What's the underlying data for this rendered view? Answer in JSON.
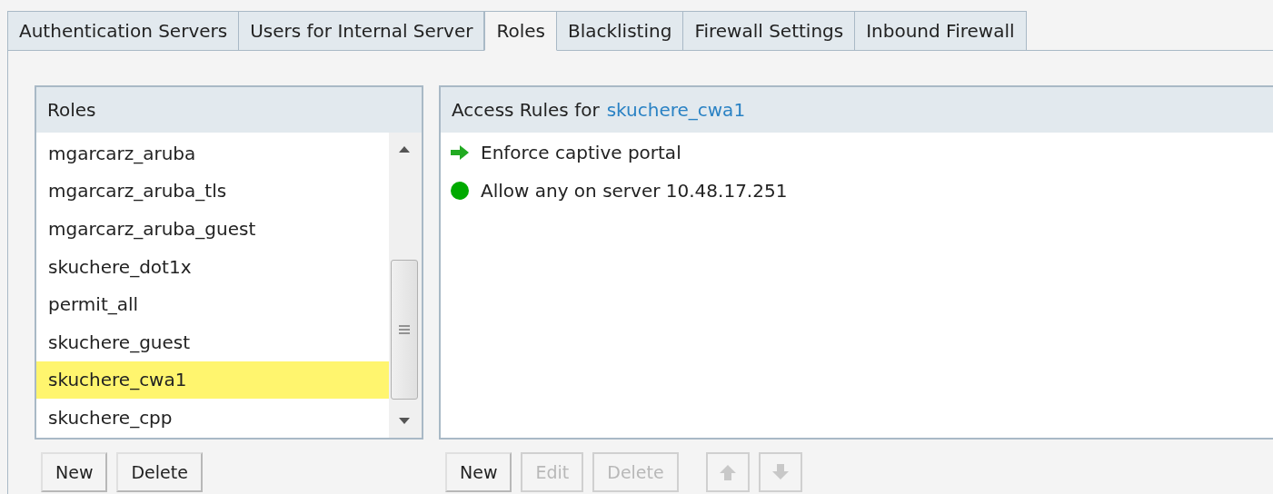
{
  "tabs": [
    {
      "label": "Authentication Servers",
      "selected": false
    },
    {
      "label": "Users for Internal Server",
      "selected": false
    },
    {
      "label": "Roles",
      "selected": true
    },
    {
      "label": "Blacklisting",
      "selected": false
    },
    {
      "label": "Firewall Settings",
      "selected": false
    },
    {
      "label": "Inbound Firewall",
      "selected": false
    }
  ],
  "roles": {
    "title": "Roles",
    "items": [
      {
        "label": "mgarcarz_aruba",
        "selected": false
      },
      {
        "label": "mgarcarz_aruba_tls",
        "selected": false
      },
      {
        "label": "mgarcarz_aruba_guest",
        "selected": false
      },
      {
        "label": "skuchere_dot1x",
        "selected": false
      },
      {
        "label": "permit_all",
        "selected": false
      },
      {
        "label": "skuchere_guest",
        "selected": false
      },
      {
        "label": "skuchere_cwa1",
        "selected": true
      },
      {
        "label": "skuchere_cpp",
        "selected": false
      }
    ],
    "buttons": [
      {
        "label": "New",
        "disabled": false
      },
      {
        "label": "Delete",
        "disabled": false
      }
    ]
  },
  "access_rules": {
    "title": "Access Rules for",
    "role": "skuchere_cwa1",
    "rules": [
      {
        "kind": "redirect",
        "label": "Enforce captive portal"
      },
      {
        "kind": "allow",
        "label": "Allow any on server 10.48.17.251"
      }
    ],
    "buttons": [
      {
        "kind": "text",
        "label": "New",
        "disabled": false
      },
      {
        "kind": "text",
        "label": "Edit",
        "disabled": true
      },
      {
        "kind": "text",
        "label": "Delete",
        "disabled": true
      },
      {
        "kind": "up",
        "disabled": true
      },
      {
        "kind": "down",
        "disabled": true
      }
    ]
  }
}
